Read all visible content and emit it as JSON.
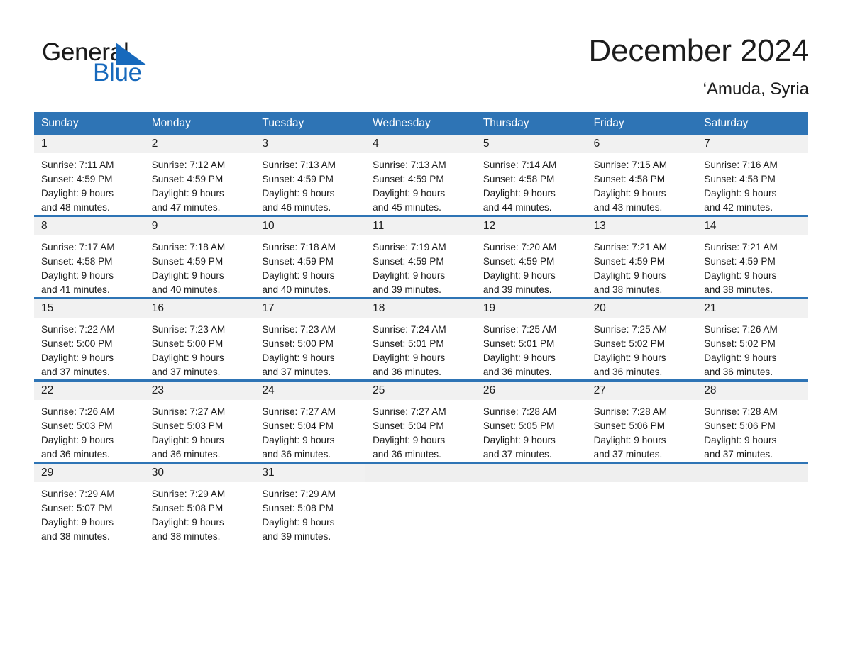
{
  "brand": {
    "word_one": "General",
    "word_two": "Blue",
    "triangle_color": "#1769bc",
    "blue_text_color": "#1769bc",
    "dark_text_color": "#1a1a1a"
  },
  "header": {
    "title": "December 2024",
    "subtitle": "‘Amuda, Syria",
    "accent_color": "#2e74b5",
    "band_color": "#f1f1f1"
  },
  "calendar": {
    "day_names": [
      "Sunday",
      "Monday",
      "Tuesday",
      "Wednesday",
      "Thursday",
      "Friday",
      "Saturday"
    ],
    "weeks": [
      [
        {
          "day": "1",
          "sunrise": "Sunrise: 7:11 AM",
          "sunset": "Sunset: 4:59 PM",
          "daylight_line1": "Daylight: 9 hours",
          "daylight_line2": "and 48 minutes."
        },
        {
          "day": "2",
          "sunrise": "Sunrise: 7:12 AM",
          "sunset": "Sunset: 4:59 PM",
          "daylight_line1": "Daylight: 9 hours",
          "daylight_line2": "and 47 minutes."
        },
        {
          "day": "3",
          "sunrise": "Sunrise: 7:13 AM",
          "sunset": "Sunset: 4:59 PM",
          "daylight_line1": "Daylight: 9 hours",
          "daylight_line2": "and 46 minutes."
        },
        {
          "day": "4",
          "sunrise": "Sunrise: 7:13 AM",
          "sunset": "Sunset: 4:59 PM",
          "daylight_line1": "Daylight: 9 hours",
          "daylight_line2": "and 45 minutes."
        },
        {
          "day": "5",
          "sunrise": "Sunrise: 7:14 AM",
          "sunset": "Sunset: 4:58 PM",
          "daylight_line1": "Daylight: 9 hours",
          "daylight_line2": "and 44 minutes."
        },
        {
          "day": "6",
          "sunrise": "Sunrise: 7:15 AM",
          "sunset": "Sunset: 4:58 PM",
          "daylight_line1": "Daylight: 9 hours",
          "daylight_line2": "and 43 minutes."
        },
        {
          "day": "7",
          "sunrise": "Sunrise: 7:16 AM",
          "sunset": "Sunset: 4:58 PM",
          "daylight_line1": "Daylight: 9 hours",
          "daylight_line2": "and 42 minutes."
        }
      ],
      [
        {
          "day": "8",
          "sunrise": "Sunrise: 7:17 AM",
          "sunset": "Sunset: 4:58 PM",
          "daylight_line1": "Daylight: 9 hours",
          "daylight_line2": "and 41 minutes."
        },
        {
          "day": "9",
          "sunrise": "Sunrise: 7:18 AM",
          "sunset": "Sunset: 4:59 PM",
          "daylight_line1": "Daylight: 9 hours",
          "daylight_line2": "and 40 minutes."
        },
        {
          "day": "10",
          "sunrise": "Sunrise: 7:18 AM",
          "sunset": "Sunset: 4:59 PM",
          "daylight_line1": "Daylight: 9 hours",
          "daylight_line2": "and 40 minutes."
        },
        {
          "day": "11",
          "sunrise": "Sunrise: 7:19 AM",
          "sunset": "Sunset: 4:59 PM",
          "daylight_line1": "Daylight: 9 hours",
          "daylight_line2": "and 39 minutes."
        },
        {
          "day": "12",
          "sunrise": "Sunrise: 7:20 AM",
          "sunset": "Sunset: 4:59 PM",
          "daylight_line1": "Daylight: 9 hours",
          "daylight_line2": "and 39 minutes."
        },
        {
          "day": "13",
          "sunrise": "Sunrise: 7:21 AM",
          "sunset": "Sunset: 4:59 PM",
          "daylight_line1": "Daylight: 9 hours",
          "daylight_line2": "and 38 minutes."
        },
        {
          "day": "14",
          "sunrise": "Sunrise: 7:21 AM",
          "sunset": "Sunset: 4:59 PM",
          "daylight_line1": "Daylight: 9 hours",
          "daylight_line2": "and 38 minutes."
        }
      ],
      [
        {
          "day": "15",
          "sunrise": "Sunrise: 7:22 AM",
          "sunset": "Sunset: 5:00 PM",
          "daylight_line1": "Daylight: 9 hours",
          "daylight_line2": "and 37 minutes."
        },
        {
          "day": "16",
          "sunrise": "Sunrise: 7:23 AM",
          "sunset": "Sunset: 5:00 PM",
          "daylight_line1": "Daylight: 9 hours",
          "daylight_line2": "and 37 minutes."
        },
        {
          "day": "17",
          "sunrise": "Sunrise: 7:23 AM",
          "sunset": "Sunset: 5:00 PM",
          "daylight_line1": "Daylight: 9 hours",
          "daylight_line2": "and 37 minutes."
        },
        {
          "day": "18",
          "sunrise": "Sunrise: 7:24 AM",
          "sunset": "Sunset: 5:01 PM",
          "daylight_line1": "Daylight: 9 hours",
          "daylight_line2": "and 36 minutes."
        },
        {
          "day": "19",
          "sunrise": "Sunrise: 7:25 AM",
          "sunset": "Sunset: 5:01 PM",
          "daylight_line1": "Daylight: 9 hours",
          "daylight_line2": "and 36 minutes."
        },
        {
          "day": "20",
          "sunrise": "Sunrise: 7:25 AM",
          "sunset": "Sunset: 5:02 PM",
          "daylight_line1": "Daylight: 9 hours",
          "daylight_line2": "and 36 minutes."
        },
        {
          "day": "21",
          "sunrise": "Sunrise: 7:26 AM",
          "sunset": "Sunset: 5:02 PM",
          "daylight_line1": "Daylight: 9 hours",
          "daylight_line2": "and 36 minutes."
        }
      ],
      [
        {
          "day": "22",
          "sunrise": "Sunrise: 7:26 AM",
          "sunset": "Sunset: 5:03 PM",
          "daylight_line1": "Daylight: 9 hours",
          "daylight_line2": "and 36 minutes."
        },
        {
          "day": "23",
          "sunrise": "Sunrise: 7:27 AM",
          "sunset": "Sunset: 5:03 PM",
          "daylight_line1": "Daylight: 9 hours",
          "daylight_line2": "and 36 minutes."
        },
        {
          "day": "24",
          "sunrise": "Sunrise: 7:27 AM",
          "sunset": "Sunset: 5:04 PM",
          "daylight_line1": "Daylight: 9 hours",
          "daylight_line2": "and 36 minutes."
        },
        {
          "day": "25",
          "sunrise": "Sunrise: 7:27 AM",
          "sunset": "Sunset: 5:04 PM",
          "daylight_line1": "Daylight: 9 hours",
          "daylight_line2": "and 36 minutes."
        },
        {
          "day": "26",
          "sunrise": "Sunrise: 7:28 AM",
          "sunset": "Sunset: 5:05 PM",
          "daylight_line1": "Daylight: 9 hours",
          "daylight_line2": "and 37 minutes."
        },
        {
          "day": "27",
          "sunrise": "Sunrise: 7:28 AM",
          "sunset": "Sunset: 5:06 PM",
          "daylight_line1": "Daylight: 9 hours",
          "daylight_line2": "and 37 minutes."
        },
        {
          "day": "28",
          "sunrise": "Sunrise: 7:28 AM",
          "sunset": "Sunset: 5:06 PM",
          "daylight_line1": "Daylight: 9 hours",
          "daylight_line2": "and 37 minutes."
        }
      ],
      [
        {
          "day": "29",
          "sunrise": "Sunrise: 7:29 AM",
          "sunset": "Sunset: 5:07 PM",
          "daylight_line1": "Daylight: 9 hours",
          "daylight_line2": "and 38 minutes."
        },
        {
          "day": "30",
          "sunrise": "Sunrise: 7:29 AM",
          "sunset": "Sunset: 5:08 PM",
          "daylight_line1": "Daylight: 9 hours",
          "daylight_line2": "and 38 minutes."
        },
        {
          "day": "31",
          "sunrise": "Sunrise: 7:29 AM",
          "sunset": "Sunset: 5:08 PM",
          "daylight_line1": "Daylight: 9 hours",
          "daylight_line2": "and 39 minutes."
        },
        {
          "day": "",
          "sunrise": "",
          "sunset": "",
          "daylight_line1": "",
          "daylight_line2": ""
        },
        {
          "day": "",
          "sunrise": "",
          "sunset": "",
          "daylight_line1": "",
          "daylight_line2": ""
        },
        {
          "day": "",
          "sunrise": "",
          "sunset": "",
          "daylight_line1": "",
          "daylight_line2": ""
        },
        {
          "day": "",
          "sunrise": "",
          "sunset": "",
          "daylight_line1": "",
          "daylight_line2": ""
        }
      ]
    ]
  }
}
